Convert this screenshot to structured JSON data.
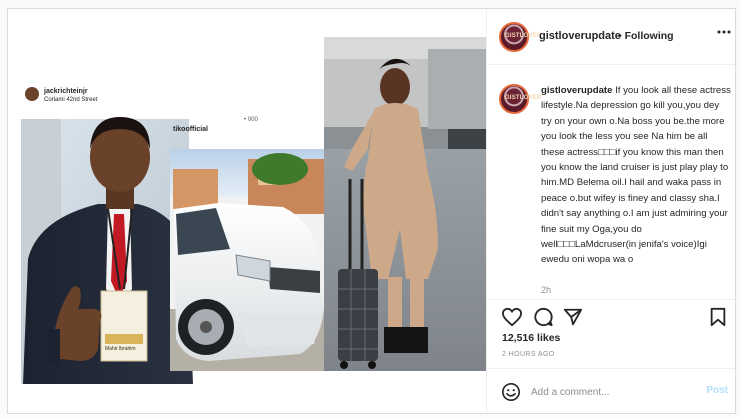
{
  "post": {
    "account": "gistloverupdate",
    "avatar_text": "GISTLOVER",
    "follow_status": "• Following",
    "more_icon": "more-horizontal-icon",
    "caption_user": "gistloverupdate",
    "caption_text": "If you look all these actress lifestyle.Na depression go kill you,you dey try on your own o.Na boss you be.the more you look the less you see Na him be all these actress□□□if you know this man then you know the land cruiser is just play play to him.MD Belema oil.I hail and waka pass in peace o.but wifey is finey and classy sha.I didn't say anything o.I am just admiring your fine suit my Oga,you do well□□□LaMdcruser(in jenifa's voice)Igi ewedu oni wopa wa o",
    "caption_time": "2h",
    "likes": "12,516 likes",
    "posted_ago": "2 HOURS AGO",
    "comment_placeholder": "Add a comment...",
    "post_button": "Post",
    "icons": {
      "like": "heart-icon",
      "comment": "comment-icon",
      "share": "share-icon",
      "save": "bookmark-icon"
    }
  },
  "media": {
    "left_user": "jackrichteinjr",
    "left_location": "Corlami 42nd Street",
    "badge_text": "Mahir Ibrahim",
    "mid_user": "tikoofficial",
    "mid_top_text": "• 000"
  }
}
